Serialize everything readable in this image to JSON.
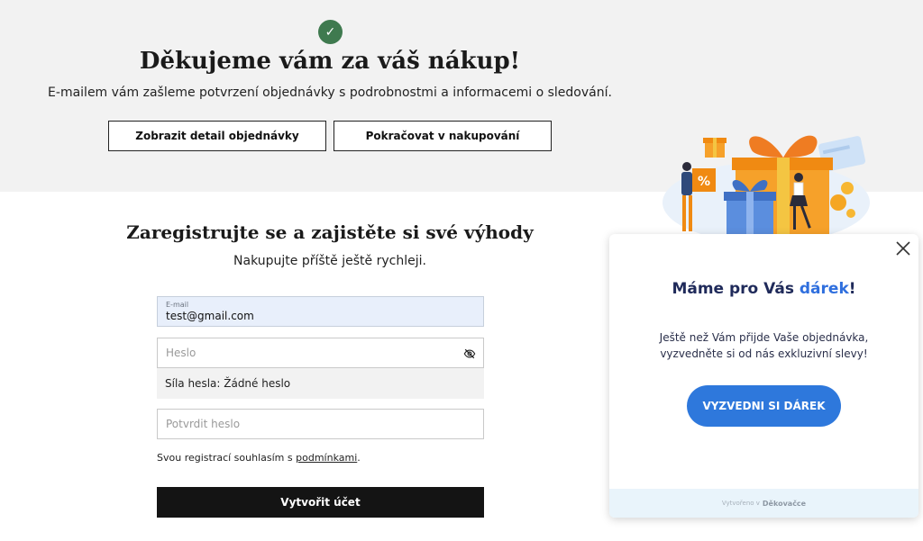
{
  "confirmation": {
    "check_icon": "check-icon",
    "title": "Děkujeme vám za váš nákup!",
    "subtitle": "E-mailem vám zašleme potvrzení objednávky s podrobnostmi a informacemi o sledování.",
    "buttons": {
      "order_detail": "Zobrazit detail objednávky",
      "continue_shopping": "Pokračovat v nakupování"
    }
  },
  "registration": {
    "title": "Zaregistrujte se a zajistěte si své výhody",
    "subtitle": "Nakupujte příště ještě rychleji.",
    "email": {
      "label": "E-mail",
      "value": "test@gmail.com"
    },
    "password": {
      "placeholder": "Heslo"
    },
    "strength_text": "Síla hesla: Žádné heslo",
    "confirm_password": {
      "placeholder": "Potvrdit heslo"
    },
    "consent": {
      "text": "Svou registrací souhlasím s ",
      "link": "podmínkami",
      "suffix": "."
    },
    "submit_label": "Vytvořit účet"
  },
  "gift_popup": {
    "heading_main": "Máme pro Vás ",
    "heading_accent": "dárek",
    "heading_end": "!",
    "text": "Ještě než Vám přijde Vaše objednávka, vyzvedněte si od nás exkluzivní slevy!",
    "cta_label": "VYZVEDNI SI DÁREK",
    "footer_prefix": "Vytvořeno v",
    "footer_brand": "Děkovačce",
    "illustration_badge": "%"
  },
  "colors": {
    "check_badge": "#3f7a4f",
    "popup_heading": "#1f2a5a",
    "popup_accent": "#2f6fde",
    "cta": "#2e78dc",
    "submit": "#141414"
  }
}
